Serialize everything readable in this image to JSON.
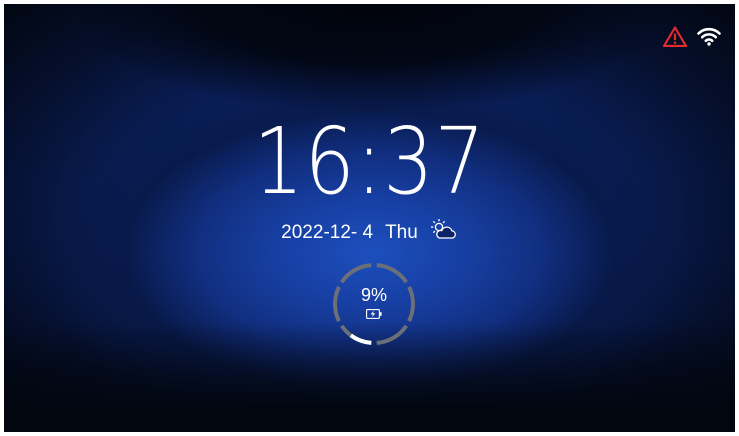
{
  "status_bar": {
    "icons": [
      "warning-icon",
      "wifi-icon"
    ],
    "warning_color": "#e32b2b"
  },
  "clock": {
    "time": "16:37"
  },
  "date_row": {
    "date": "2022-12- 4",
    "weekday": "Thu",
    "weather_icon": "partly-cloudy-icon"
  },
  "battery": {
    "percent_label": "9%",
    "level": 0.09,
    "charging_icon": "battery-charging-icon",
    "ring_colors": {
      "track": "#6b6f78",
      "fill": "#ffffff"
    }
  }
}
